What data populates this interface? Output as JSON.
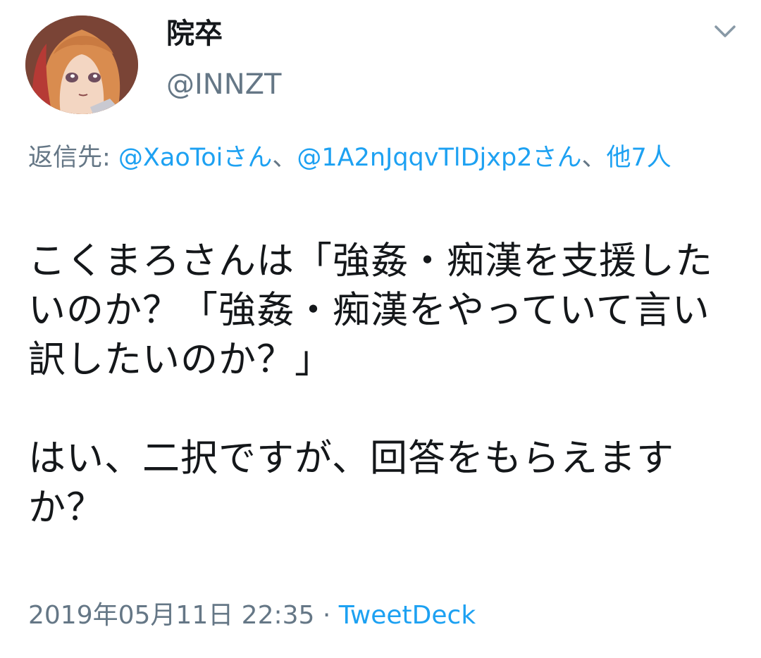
{
  "author": {
    "display_name": "院卒",
    "handle": "@INNZT",
    "avatar_icon": "anime-girl-avatar"
  },
  "menu": {
    "icon": "chevron-down-icon"
  },
  "reply_context": {
    "prefix": "返信先: ",
    "mention_1": "@XaoToiさん",
    "separator_1": "、",
    "mention_2": "@1A2nJqqvTlDjxp2さん",
    "separator_2": "、",
    "others": "他7人"
  },
  "tweet": {
    "paragraph_1": "こくまろさんは「強姦・痴漢を支援したいのか？「強姦・痴漢をやっていて言い訳したいのか？」",
    "paragraph_2": "はい、二択ですが、回答をもらえますか？"
  },
  "meta": {
    "timestamp": "2019年05月11日 22:35",
    "separator": " · ",
    "source": "TweetDeck"
  },
  "colors": {
    "text": "#14171a",
    "secondary": "#657786",
    "link": "#1da1f2"
  }
}
